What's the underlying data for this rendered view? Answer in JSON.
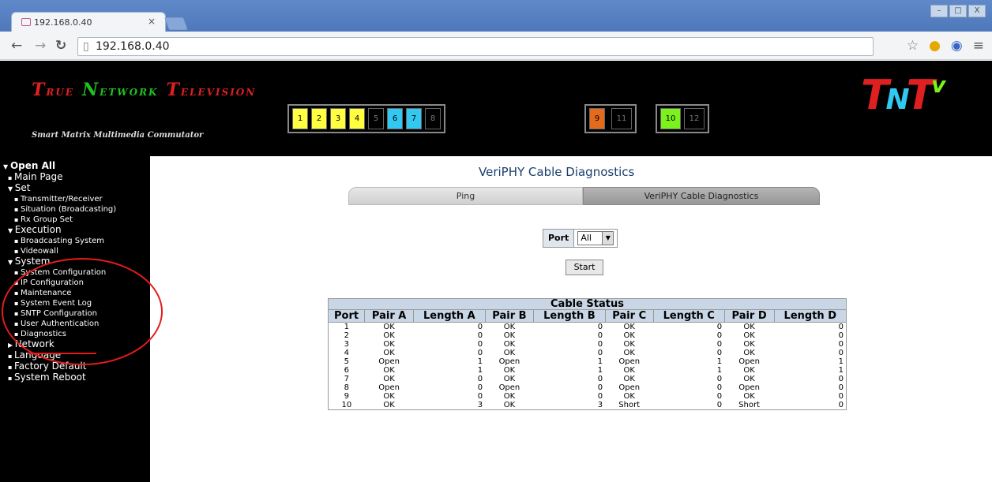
{
  "browser": {
    "tab_title": "192.168.0.40",
    "tab_close": "×",
    "url": "192.168.0.40",
    "window_buttons": [
      "–",
      "□",
      "X"
    ]
  },
  "banner": {
    "logo_left": [
      {
        "cap": "T",
        "rest": "RUE"
      },
      {
        "cap": "N",
        "rest": "ETWORK"
      },
      {
        "cap": "T",
        "rest": "ELEVISION"
      }
    ],
    "subtitle": "Smart Matrix Multimedia Commutator",
    "port_group_1": [
      {
        "label": "1",
        "color": "#ffff40"
      },
      {
        "label": "2",
        "color": "#ffff40"
      },
      {
        "label": "3",
        "color": "#ffff40"
      },
      {
        "label": "4",
        "color": "#ffff40"
      },
      {
        "label": "5",
        "color": "#000000"
      },
      {
        "label": "6",
        "color": "#31c8f2"
      },
      {
        "label": "7",
        "color": "#31c8f2"
      },
      {
        "label": "8",
        "color": "#000000"
      }
    ],
    "port_group_2": [
      {
        "label": "9",
        "color": "#e56b1c"
      },
      {
        "label": "11",
        "color": "#000000"
      }
    ],
    "port_group_3": [
      {
        "label": "10",
        "color": "#7bf21c"
      },
      {
        "label": "12",
        "color": "#000000"
      }
    ],
    "logo_right": [
      "T",
      "N",
      "T",
      "v"
    ]
  },
  "sidebar": [
    {
      "label": "Open All",
      "level": 0,
      "icon": "triangle-down-icon"
    },
    {
      "label": "Main Page",
      "level": 1,
      "icon": "bullet"
    },
    {
      "label": "Set",
      "level": 1,
      "icon": "triangle-down-icon"
    },
    {
      "label": "Transmitter/Receiver",
      "level": 2,
      "icon": "bullet"
    },
    {
      "label": "Situation (Broadcasting)",
      "level": 2,
      "icon": "bullet"
    },
    {
      "label": "Rx Group Set",
      "level": 2,
      "icon": "bullet"
    },
    {
      "label": "Execution",
      "level": 1,
      "icon": "triangle-down-icon"
    },
    {
      "label": "Broadcasting System",
      "level": 2,
      "icon": "bullet"
    },
    {
      "label": "Videowall",
      "level": 2,
      "icon": "bullet"
    },
    {
      "label": "System",
      "level": 1,
      "icon": "triangle-down-icon"
    },
    {
      "label": "System Configuration",
      "level": 2,
      "icon": "bullet"
    },
    {
      "label": "IP Configuration",
      "level": 2,
      "icon": "bullet"
    },
    {
      "label": "Maintenance",
      "level": 2,
      "icon": "bullet"
    },
    {
      "label": "System Event Log",
      "level": 2,
      "icon": "bullet"
    },
    {
      "label": "SNTP Configuration",
      "level": 2,
      "icon": "bullet"
    },
    {
      "label": "User Authentication",
      "level": 2,
      "icon": "bullet"
    },
    {
      "label": "Diagnostics",
      "level": 2,
      "icon": "bullet"
    },
    {
      "label": "Network",
      "level": 1,
      "icon": "triangle-right-icon"
    },
    {
      "label": "Language",
      "level": 1,
      "icon": "bullet"
    },
    {
      "label": "Factory Default",
      "level": 1,
      "icon": "bullet"
    },
    {
      "label": "System Reboot",
      "level": 1,
      "icon": "bullet"
    }
  ],
  "main": {
    "title": "VeriPHY Cable Diagnostics",
    "tabs": [
      "Ping",
      "VeriPHY Cable Diagnostics"
    ],
    "port_label": "Port",
    "port_value": "All",
    "start_label": "Start",
    "table_caption": "Cable Status",
    "columns": [
      "Port",
      "Pair A",
      "Length A",
      "Pair B",
      "Length B",
      "Pair C",
      "Length C",
      "Pair D",
      "Length D"
    ],
    "rows": [
      [
        "1",
        "OK",
        "0",
        "OK",
        "0",
        "OK",
        "0",
        "OK",
        "0"
      ],
      [
        "2",
        "OK",
        "0",
        "OK",
        "0",
        "OK",
        "0",
        "OK",
        "0"
      ],
      [
        "3",
        "OK",
        "0",
        "OK",
        "0",
        "OK",
        "0",
        "OK",
        "0"
      ],
      [
        "4",
        "OK",
        "0",
        "OK",
        "0",
        "OK",
        "0",
        "OK",
        "0"
      ],
      [
        "5",
        "Open",
        "1",
        "Open",
        "1",
        "Open",
        "1",
        "Open",
        "1"
      ],
      [
        "6",
        "OK",
        "1",
        "OK",
        "1",
        "OK",
        "1",
        "OK",
        "1"
      ],
      [
        "7",
        "OK",
        "0",
        "OK",
        "0",
        "OK",
        "0",
        "OK",
        "0"
      ],
      [
        "8",
        "Open",
        "0",
        "Open",
        "0",
        "Open",
        "0",
        "Open",
        "0"
      ],
      [
        "9",
        "OK",
        "0",
        "OK",
        "0",
        "OK",
        "0",
        "OK",
        "0"
      ],
      [
        "10",
        "OK",
        "3",
        "OK",
        "3",
        "Short",
        "0",
        "Short",
        "0"
      ]
    ]
  }
}
